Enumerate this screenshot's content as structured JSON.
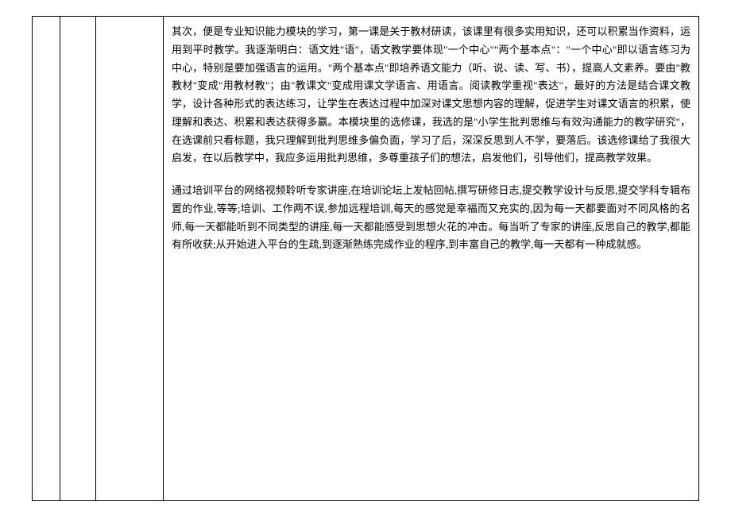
{
  "content": {
    "paragraph1": "其次，便是专业知识能力模块的学习，第一课是关于教材研读，该课里有很多实用知识，还可以积累当作资料，运用到平时教学。我逐渐明白：语文姓\"语\"，语文教学要体现\"一个中心\"\"两个基本点\"：\"一个中心\"即以语言练习为中心，特别是要加强语言的运用。\"两个基本点\"即培养语文能力（听、说、读、写、书），提高人文素养。要由\"教教材\"变成\"用教材教\"；由\"教课文\"变成用课文学语言、用语言。阅读教学重视\"表达\"，最好的方法是结合课文教学，设计各种形式的表达练习，让学生在表达过程中加深对课文思想内容的理解，促进学生对课文语言的积累，使理解和表达、积累和表达获得多赢。本模块里的选修课，我选的是\"小学生批判思维与有效沟通能力的教学研究\"，在选课前只看标题，我只理解到批判思维多偏负面，学习了后，深深反思到人不学，要落后。该选修课给了我很大启发，在以后教学中，我应多运用批判思维，多尊重孩子们的想法，启发他们，引导他们，提高教学效果。",
    "paragraph2": "通过培训平台的网络视频聆听专家讲座,在培训论坛上发帖回帖,撰写研修日志,提交教学设计与反思,提交学科专辑布置的作业,等等;培训、工作两不误,参加远程培训,每天的感觉是幸福而又充实的,因为每一天都要面对不同风格的名师,每一天都能听到不同类型的讲座,每一天都能感受到思想火花的冲击。每当听了专家的讲座,反思自己的教学,都能有所收获;从开始进入平台的生疏,到逐渐熟练完成作业的程序,到丰富自己的教学,每一天都有一种成就感。"
  }
}
